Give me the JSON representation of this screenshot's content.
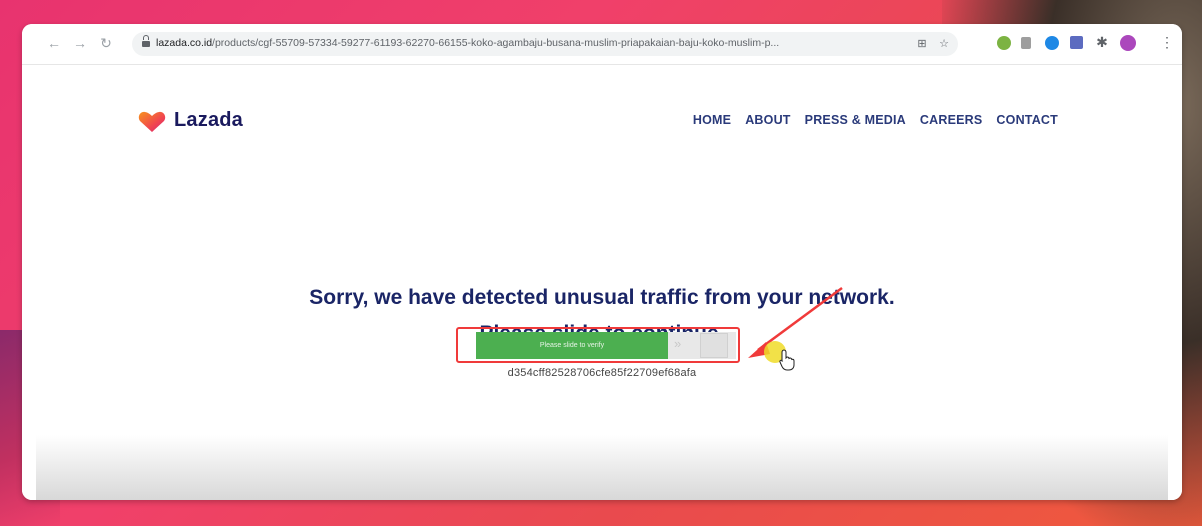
{
  "browser": {
    "url_host": "lazada.co.id",
    "url_path": "/products/cgf-55709-57334-59277-61193-62270-66155-koko-agambaju-busana-muslim-priapakaian-baju-koko-muslim-p..."
  },
  "header": {
    "brand": "Lazada",
    "nav": [
      "HOME",
      "ABOUT",
      "PRESS & MEDIA",
      "CAREERS",
      "CONTACT"
    ]
  },
  "main": {
    "message_line1": "Sorry, we have detected unusual traffic from your network.",
    "message_line2": "Please slide to continue.",
    "slider_label": "Please slide to verify",
    "slider_arrows": "»",
    "slider_progress": 0.74,
    "token": "d354cff82528706cfe85f22709ef68afa"
  },
  "colors": {
    "brand_navy": "#1a2566",
    "slider_green": "#4caf50",
    "highlight_red": "#f03a3a"
  }
}
